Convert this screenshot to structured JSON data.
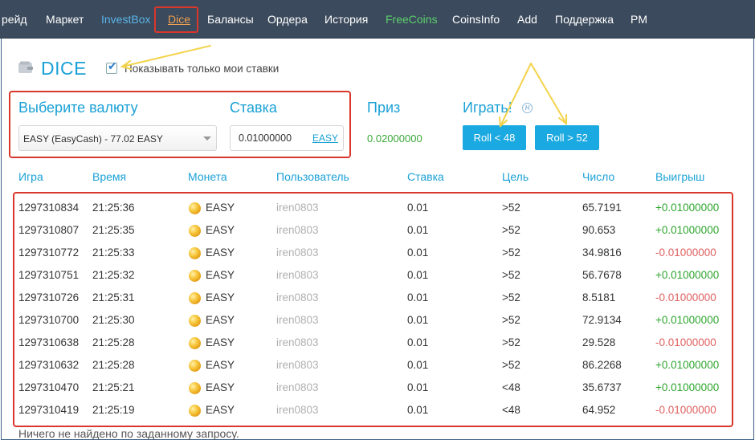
{
  "nav": {
    "items": [
      {
        "label": "рейд",
        "style": "normal"
      },
      {
        "label": "Маркет",
        "style": "normal"
      },
      {
        "label": "InvestBox",
        "style": "blue"
      },
      {
        "label": "Dice",
        "style": "active"
      },
      {
        "label": "Балансы",
        "style": "normal"
      },
      {
        "label": "Ордера",
        "style": "normal"
      },
      {
        "label": "История",
        "style": "normal"
      },
      {
        "label": "FreeCoins",
        "style": "green"
      },
      {
        "label": "CoinsInfo",
        "style": "normal"
      },
      {
        "label": "Add",
        "style": "normal"
      },
      {
        "label": "Поддержка",
        "style": "normal"
      },
      {
        "label": "PM",
        "style": "normal"
      }
    ]
  },
  "header": {
    "title": "DICE",
    "only_my_bets_label": "Показывать только мои ставки",
    "only_my_bets_checked": true
  },
  "form": {
    "currency_heading": "Выберите валюту",
    "currency_value": "EASY (EasyCash) - 77.02 EASY",
    "bet_heading": "Ставка",
    "bet_value": "0.01000000",
    "bet_currency": "EASY",
    "prize_heading": "Приз",
    "prize_value": "0.02000000",
    "play_heading": "Играть!",
    "roll_low_label": "Roll < 48",
    "roll_high_label": "Roll > 52"
  },
  "table": {
    "columns": [
      "Игра",
      "Время",
      "Монета",
      "Пользователь",
      "Ставка",
      "Цель",
      "Число",
      "Выигрыш"
    ],
    "rows": [
      {
        "game": "1297310834",
        "time": "21:25:36",
        "coin": "EASY",
        "user": "iren0803",
        "bet": "0.01",
        "target": ">52",
        "number": "65.7191",
        "win": "+0.01000000",
        "won": true
      },
      {
        "game": "1297310807",
        "time": "21:25:35",
        "coin": "EASY",
        "user": "iren0803",
        "bet": "0.01",
        "target": ">52",
        "number": "90.653",
        "win": "+0.01000000",
        "won": true
      },
      {
        "game": "1297310772",
        "time": "21:25:33",
        "coin": "EASY",
        "user": "iren0803",
        "bet": "0.01",
        "target": ">52",
        "number": "34.9816",
        "win": "-0.01000000",
        "won": false
      },
      {
        "game": "1297310751",
        "time": "21:25:32",
        "coin": "EASY",
        "user": "iren0803",
        "bet": "0.01",
        "target": ">52",
        "number": "56.7678",
        "win": "+0.01000000",
        "won": true
      },
      {
        "game": "1297310726",
        "time": "21:25:31",
        "coin": "EASY",
        "user": "iren0803",
        "bet": "0.01",
        "target": ">52",
        "number": "8.5181",
        "win": "-0.01000000",
        "won": false
      },
      {
        "game": "1297310700",
        "time": "21:25:30",
        "coin": "EASY",
        "user": "iren0803",
        "bet": "0.01",
        "target": ">52",
        "number": "72.9134",
        "win": "+0.01000000",
        "won": true
      },
      {
        "game": "1297310638",
        "time": "21:25:28",
        "coin": "EASY",
        "user": "iren0803",
        "bet": "0.01",
        "target": ">52",
        "number": "29.528",
        "win": "-0.01000000",
        "won": false
      },
      {
        "game": "1297310632",
        "time": "21:25:28",
        "coin": "EASY",
        "user": "iren0803",
        "bet": "0.01",
        "target": ">52",
        "number": "86.2268",
        "win": "+0.01000000",
        "won": true
      },
      {
        "game": "1297310470",
        "time": "21:25:21",
        "coin": "EASY",
        "user": "iren0803",
        "bet": "0.01",
        "target": "<48",
        "number": "35.6737",
        "win": "+0.01000000",
        "won": true
      },
      {
        "game": "1297310419",
        "time": "21:25:19",
        "coin": "EASY",
        "user": "iren0803",
        "bet": "0.01",
        "target": "<48",
        "number": "64.952",
        "win": "-0.01000000",
        "won": false
      }
    ],
    "footer_message": "Ничего не найдено по заданному запросу."
  },
  "colors": {
    "nav_bg": "#3b4a5c",
    "accent": "#1ba1d6",
    "button": "#1ba9e1",
    "win": "#2ea52e",
    "loss": "#e06060",
    "highlight_box": "#d9372b",
    "arrow": "#f3d34a"
  },
  "icons": {
    "title": "wallet-icon",
    "help": "help-icon",
    "coin": "coin-icon"
  }
}
